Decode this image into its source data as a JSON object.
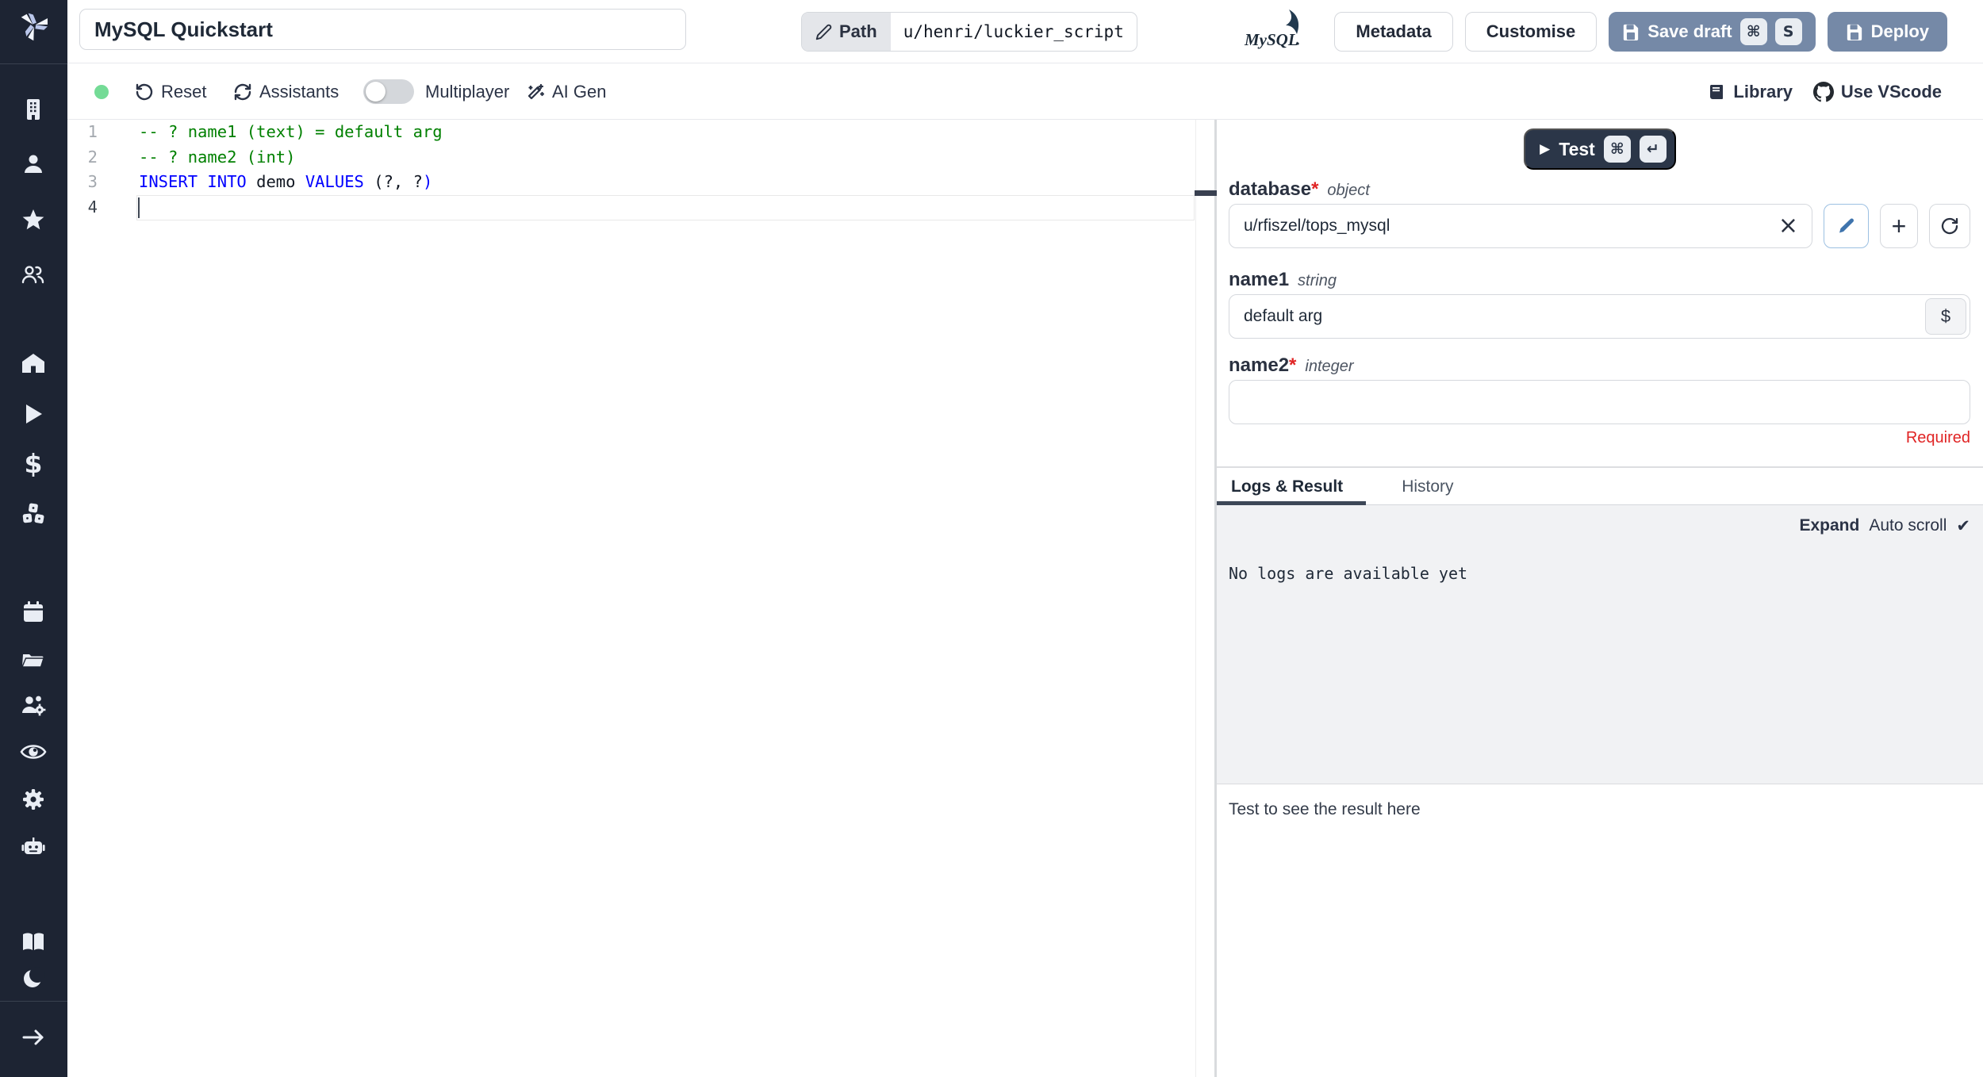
{
  "colors": {
    "accent_blue": "#7589a7",
    "dark_navy": "#2b3648",
    "sidebar_bg": "#1d2433",
    "status_green": "#74db96",
    "required_red": "#e02424",
    "comment_green": "#008000",
    "keyword_blue": "#0000ff"
  },
  "icons": {
    "clear": "×",
    "plus": "+",
    "dollar": "$",
    "play": "▶",
    "check": "✔",
    "arrow_right": "→",
    "kbd_mod": "⌘",
    "kbd_enter": "↵",
    "kbd_key_s": "S"
  },
  "sidebar": {
    "icons": [
      "windmill-logo",
      "building",
      "user",
      "star",
      "users",
      "home",
      "play",
      "dollar-sign",
      "boxes",
      "calendar",
      "folder-open",
      "users-settings",
      "eye",
      "gear",
      "robot",
      "book-open",
      "moon",
      "arrow-right"
    ]
  },
  "topbar": {
    "title_value": "MySQL Quickstart",
    "path_label": "Path",
    "path_value": "u/henri/luckier_script",
    "mysql_label": "MySQL",
    "metadata_label": "Metadata",
    "customise_label": "Customise",
    "save_draft_label": "Save draft",
    "deploy_label": "Deploy"
  },
  "toolbar": {
    "reset_label": "Reset",
    "assistants_label": "Assistants",
    "multiplayer_label": "Multiplayer",
    "ai_gen_label": "AI Gen",
    "library_label": "Library",
    "vscode_label": "Use VScode"
  },
  "editor": {
    "lines": [
      {
        "number": "1",
        "tokens": [
          {
            "text": "-- ? name1 (text) = default arg",
            "type": "comment"
          }
        ]
      },
      {
        "number": "2",
        "tokens": [
          {
            "text": "-- ? name2 (int)",
            "type": "comment"
          }
        ]
      },
      {
        "number": "3",
        "tokens": [
          {
            "text": "INSERT INTO",
            "type": "keyword"
          },
          {
            "text": " demo ",
            "type": "plain"
          },
          {
            "text": "VALUES",
            "type": "keyword"
          },
          {
            "text": " (?, ?",
            "type": "plain"
          },
          {
            "text": ")",
            "type": "keyword"
          }
        ]
      },
      {
        "number": "4",
        "tokens": []
      }
    ]
  },
  "panel": {
    "test": {
      "label": "Test"
    },
    "fields": {
      "database": {
        "name": "database",
        "required_mark": "*",
        "type": "object",
        "value": "u/rfiszel/tops_mysql"
      },
      "name1": {
        "name": "name1",
        "type": "string",
        "value": "default arg",
        "addon": "$"
      },
      "name2": {
        "name": "name2",
        "required_mark": "*",
        "type": "integer",
        "value": "",
        "error": "Required"
      }
    },
    "tabs": {
      "logs": "Logs & Result",
      "history": "History"
    },
    "logs": {
      "expand": "Expand",
      "autoscroll": "Auto scroll",
      "empty": "No logs are available yet"
    },
    "result": {
      "placeholder": "Test to see the result here"
    }
  }
}
